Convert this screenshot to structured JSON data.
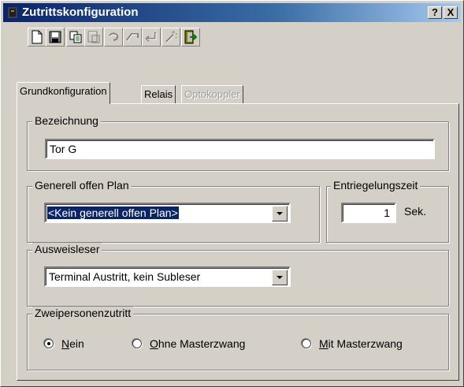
{
  "window": {
    "title": "Zutrittskonfiguration",
    "help_label": "?",
    "close_label": "X"
  },
  "toolbar": {
    "buttons": [
      {
        "name": "new-icon"
      },
      {
        "name": "save-icon"
      },
      {
        "name": "copy-icon"
      },
      {
        "name": "paste-icon"
      },
      {
        "name": "undo-icon"
      },
      {
        "name": "redo-icon"
      },
      {
        "name": "return-icon"
      },
      {
        "name": "wand-icon"
      },
      {
        "name": "exit-icon"
      }
    ]
  },
  "tabs": [
    {
      "label": "Grundkonfiguration",
      "active": true
    },
    {
      "label": "Relais",
      "active": false
    },
    {
      "label": "Optokoppler",
      "active": false,
      "disabled": true
    }
  ],
  "bezeichnung": {
    "legend": "Bezeichnung",
    "value": "Tor G"
  },
  "generell": {
    "legend": "Generell offen Plan",
    "selected": "<Kein generell offen Plan>"
  },
  "entriegelung": {
    "legend": "Entriegelungszeit",
    "value": "1",
    "unit": "Sek."
  },
  "ausweisleser": {
    "legend": "Ausweisleser",
    "selected": "Terminal Austritt, kein Subleser"
  },
  "zweipersonen": {
    "legend": "Zweipersonenzutritt",
    "options": [
      {
        "hotkey": "N",
        "rest": "ein",
        "checked": true
      },
      {
        "hotkey": "O",
        "rest": "hne Masterzwang",
        "checked": false
      },
      {
        "hotkey": "M",
        "rest": "it Masterzwang",
        "checked": false
      }
    ]
  }
}
